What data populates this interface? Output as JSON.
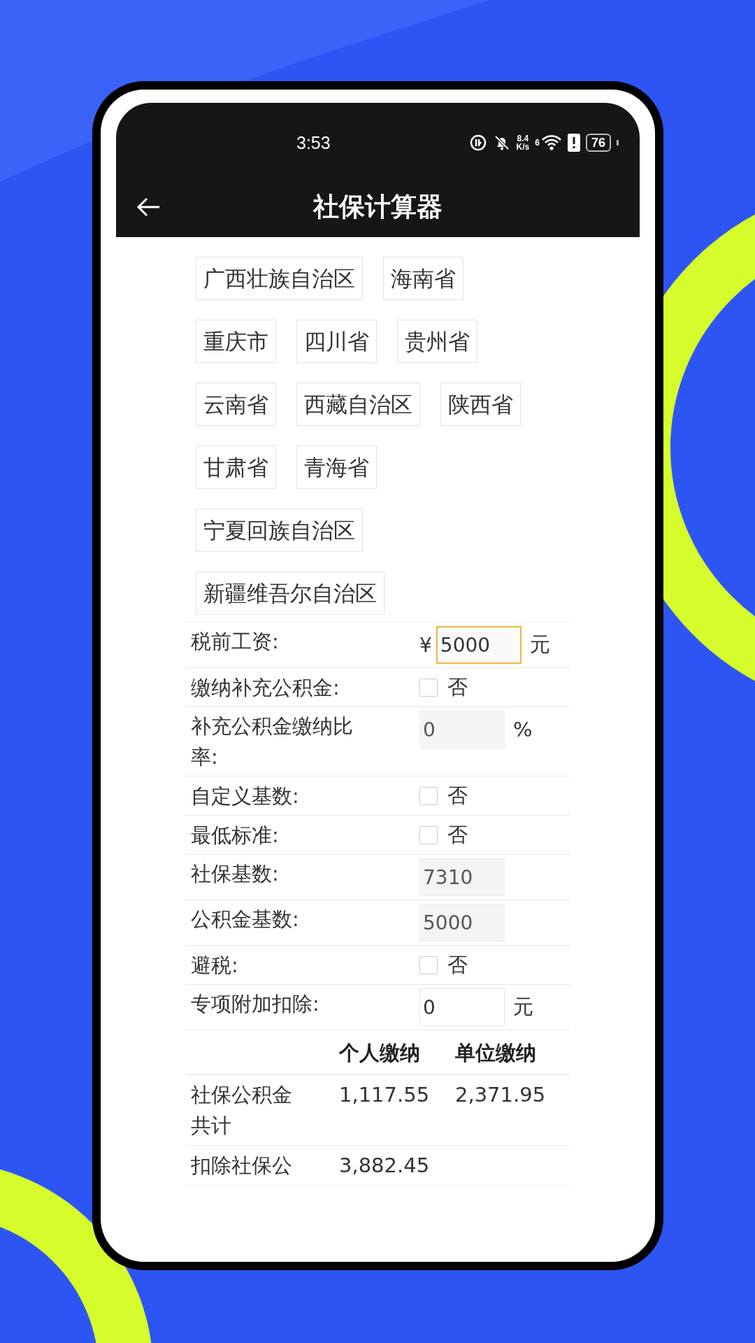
{
  "status_bar": {
    "time": "3:53",
    "speed_value": "8.4",
    "speed_unit": "K/s",
    "network_label": "6",
    "battery": "76"
  },
  "header": {
    "title": "社保计算器"
  },
  "region_rows": [
    {
      "chips": [
        "广西壮族自治区",
        "海南省"
      ]
    },
    {
      "chips": [
        "重庆市",
        "四川省",
        "贵州省"
      ]
    },
    {
      "chips": [
        "云南省",
        "西藏自治区",
        "陕西省"
      ]
    },
    {
      "chips": [
        "甘肃省",
        "青海省"
      ]
    },
    {
      "chips": [
        "宁夏回族自治区"
      ]
    },
    {
      "chips": [
        "新疆维吾尔自治区"
      ]
    }
  ],
  "form": [
    {
      "kind": "input",
      "label": "税前工资:",
      "prefix": "¥",
      "value": "5000",
      "suffix": "元",
      "focused": true,
      "disabled": false
    },
    {
      "kind": "checkbox",
      "label": "缴纳补充公积金:",
      "checked": false,
      "text": "否"
    },
    {
      "kind": "input",
      "label": "补充公积金缴纳比率:",
      "value": "0",
      "suffix": "%",
      "focused": false,
      "disabled": true
    },
    {
      "kind": "checkbox",
      "label": "自定义基数:",
      "checked": false,
      "text": "否"
    },
    {
      "kind": "checkbox",
      "label": "最低标准:",
      "checked": false,
      "text": "否"
    },
    {
      "kind": "input",
      "label": "社保基数:",
      "value": "7310",
      "focused": false,
      "disabled": true
    },
    {
      "kind": "input",
      "label": "公积金基数:",
      "value": "5000",
      "focused": false,
      "disabled": true
    },
    {
      "kind": "checkbox",
      "label": "避税:",
      "checked": false,
      "text": "否"
    },
    {
      "kind": "input",
      "label": "专项附加扣除:",
      "value": "0",
      "suffix": "元",
      "focused": false,
      "disabled": false
    }
  ],
  "results": {
    "columns": [
      "个人缴纳",
      "单位缴纳"
    ],
    "rows": [
      {
        "label": "社保公积金共计",
        "personal": "1,117.55",
        "company": "2,371.95"
      },
      {
        "label": "扣除社保公",
        "personal": "3,882.45"
      }
    ]
  }
}
